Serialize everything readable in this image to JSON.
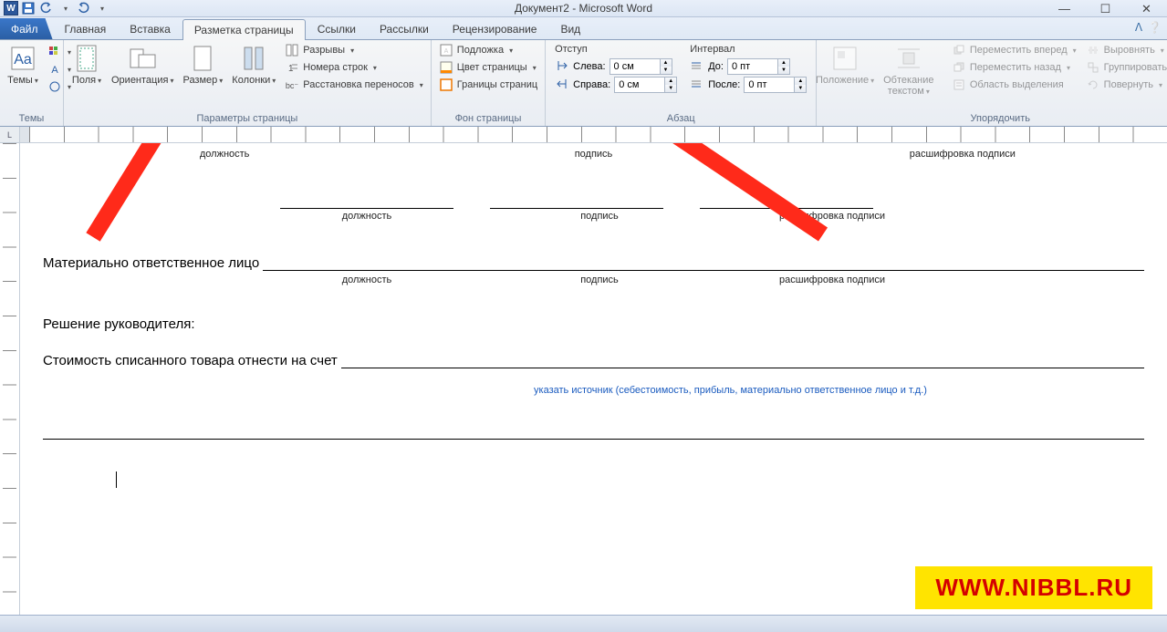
{
  "title": "Документ2 - Microsoft Word",
  "tabs": {
    "file": "Файл",
    "home": "Главная",
    "insert": "Вставка",
    "layout": "Разметка страницы",
    "references": "Ссылки",
    "mailings": "Рассылки",
    "review": "Рецензирование",
    "view": "Вид"
  },
  "groups": {
    "themes": {
      "label": "Темы",
      "themes_btn": "Темы"
    },
    "page_setup": {
      "label": "Параметры страницы",
      "margins": "Поля",
      "orientation": "Ориентация",
      "size": "Размер",
      "columns": "Колонки",
      "breaks": "Разрывы",
      "line_numbers": "Номера строк",
      "hyphenation": "Расстановка переносов"
    },
    "page_bg": {
      "label": "Фон страницы",
      "watermark": "Подложка",
      "page_color": "Цвет страницы",
      "page_borders": "Границы страниц"
    },
    "paragraph": {
      "label": "Абзац",
      "indent_title": "Отступ",
      "spacing_title": "Интервал",
      "left": "Слева:",
      "right": "Справа:",
      "before": "До:",
      "after": "После:",
      "left_val": "0 см",
      "right_val": "0 см",
      "before_val": "0 пт",
      "after_val": "0 пт"
    },
    "arrange": {
      "label": "Упорядочить",
      "position": "Положение",
      "wrap": "Обтекание текстом",
      "bring_forward": "Переместить вперед",
      "send_backward": "Переместить назад",
      "selection_pane": "Область выделения",
      "align": "Выровнять",
      "group": "Группировать",
      "rotate": "Повернуть"
    }
  },
  "doc": {
    "position": "должность",
    "signature": "подпись",
    "decryption": "расшифровка подписи",
    "responsible": "Материально ответственное лицо",
    "decision": "Решение руководителя:",
    "cost_line": "Стоимость списанного товара отнести на счет",
    "source_hint": "указать источник (себестоимость, прибыль, материально ответственное лицо и т.д.)"
  },
  "watermark_text": "WWW.NIBBL.RU",
  "icons": {
    "save": "save-icon",
    "undo": "undo-icon",
    "redo": "redo-icon"
  }
}
